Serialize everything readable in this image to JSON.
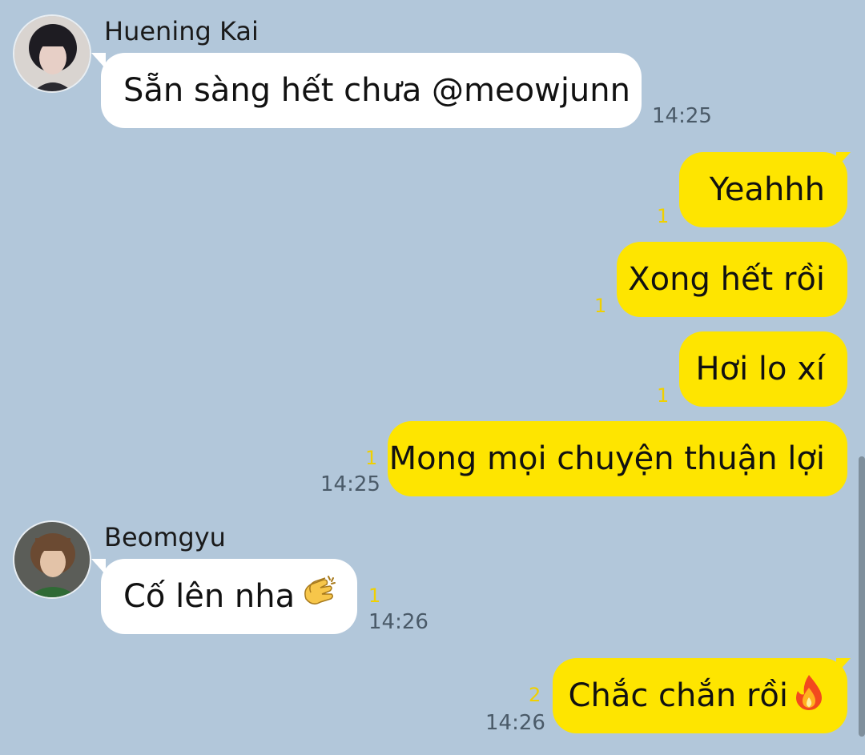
{
  "messages": [
    {
      "sender": "Huening Kai",
      "text": "Sẵn sàng hết chưa @meowjunn",
      "time": "14:25"
    },
    {
      "text": "Yeahhh",
      "unread": "1"
    },
    {
      "text": "Xong hết rồi",
      "unread": "1"
    },
    {
      "text": "Hơi lo xí",
      "unread": "1"
    },
    {
      "text": "Mong mọi chuyện thuận lợi",
      "unread": "1",
      "time": "14:25"
    },
    {
      "sender": "Beomgyu",
      "text": "Cố lên nha",
      "emoji": "clapping-hands-icon",
      "unread": "1",
      "time": "14:26"
    },
    {
      "text": "Chắc chắn rồi",
      "emoji": "fire-icon",
      "unread": "2",
      "time": "14:26"
    }
  ],
  "colors": {
    "background": "#b2c7da",
    "outgoing_bubble": "#fee500",
    "incoming_bubble": "#ffffff",
    "unread_count": "#f0d000"
  }
}
